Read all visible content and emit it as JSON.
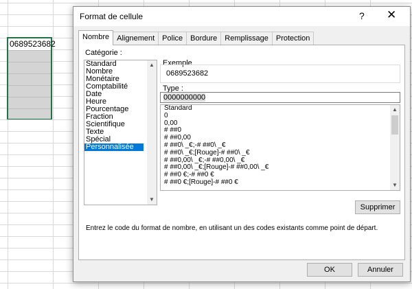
{
  "sheet": {
    "cell_value": "0689523682"
  },
  "dialog": {
    "title": "Format de cellule",
    "help": "?",
    "close": "✕",
    "tabs": [
      "Nombre",
      "Alignement",
      "Police",
      "Bordure",
      "Remplissage",
      "Protection"
    ],
    "category_label": "Catégorie :",
    "categories": [
      "Standard",
      "Nombre",
      "Monétaire",
      "Comptabilité",
      "Date",
      "Heure",
      "Pourcentage",
      "Fraction",
      "Scientifique",
      "Texte",
      "Spécial",
      "Personnalisée"
    ],
    "selected_category": "Personnalisée",
    "example_label": "Exemple",
    "example_value": "0689523682",
    "type_label": "Type :",
    "type_value": "0000000000",
    "formats": [
      "Standard",
      "0",
      "0,00",
      "# ##0",
      "# ##0,00",
      "# ##0\\ _€;-# ##0\\ _€",
      "# ##0\\ _€;[Rouge]-# ##0\\ _€",
      "# ##0,00\\ _€;-# ##0,00\\ _€",
      "# ##0,00\\ _€;[Rouge]-# ##0,00\\ _€",
      "# ##0 €;-# ##0 €",
      "# ##0 €;[Rouge]-# ##0 €"
    ],
    "delete_label": "Supprimer",
    "description": "Entrez le code du format de nombre, en utilisant un des codes existants comme point de départ.",
    "ok_label": "OK",
    "cancel_label": "Annuler"
  },
  "colors": {
    "selection_accent": "#0078d7",
    "excel_green": "#217346"
  }
}
